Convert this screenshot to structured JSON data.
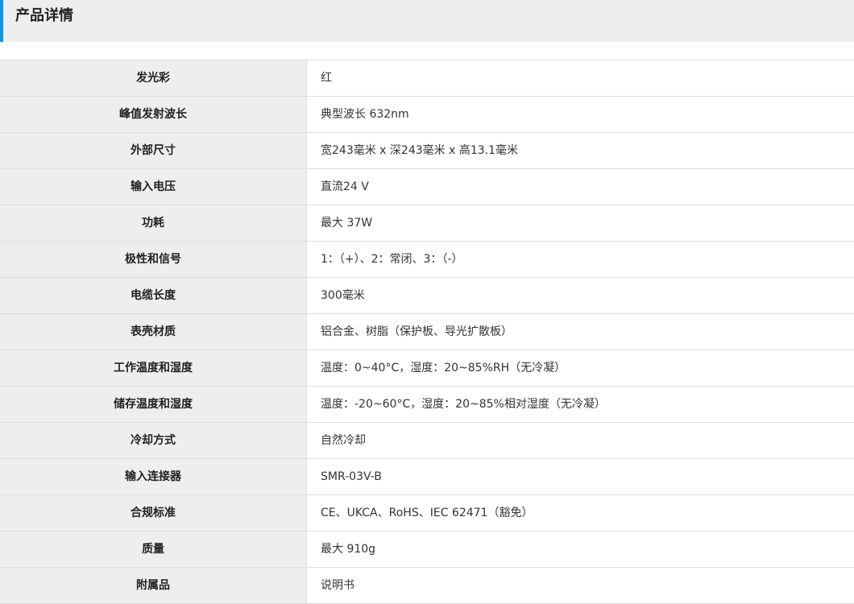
{
  "header": {
    "title": "产品详情"
  },
  "specs": [
    {
      "label": "发光彩",
      "value": "红"
    },
    {
      "label": "峰值发射波长",
      "value": "典型波长 632nm"
    },
    {
      "label": "外部尺寸",
      "value": "宽243毫米 x 深243毫米 x 高13.1毫米"
    },
    {
      "label": "输入电压",
      "value": "直流24 V"
    },
    {
      "label": "功耗",
      "value": "最大 37W"
    },
    {
      "label": "极性和信号",
      "value": "1：（+）、2：常闭、3：（-）"
    },
    {
      "label": "电缆长度",
      "value": "300毫米"
    },
    {
      "label": "表壳材质",
      "value": "铝合金、树脂（保护板、导光扩散板）"
    },
    {
      "label": "工作温度和湿度",
      "value": "温度：0~40°C，湿度：20~85%RH（无冷凝）"
    },
    {
      "label": "储存温度和湿度",
      "value": "温度：-20~60°C，湿度：20~85%相对湿度（无冷凝）"
    },
    {
      "label": "冷却方式",
      "value": "自然冷却"
    },
    {
      "label": "输入连接器",
      "value": "SMR-03V-B"
    },
    {
      "label": "合规标准",
      "value": "CE、UKCA、RoHS、IEC 62471（豁免）"
    },
    {
      "label": "质量",
      "value": "最大 910g"
    },
    {
      "label": "附属品",
      "value": "说明书"
    }
  ]
}
